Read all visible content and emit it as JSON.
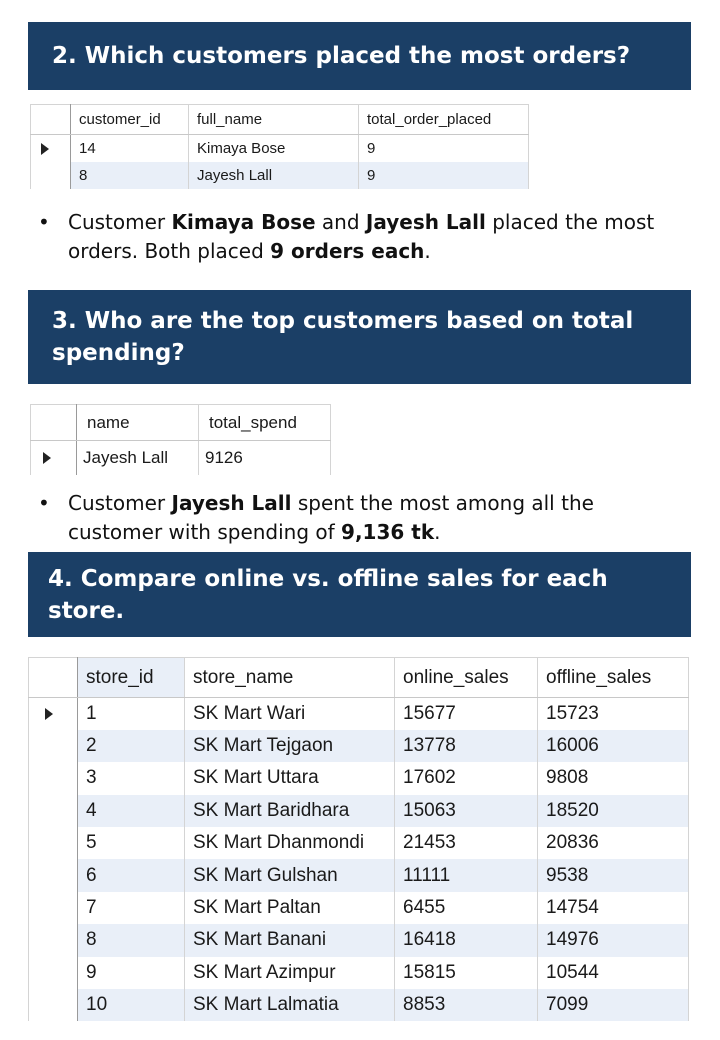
{
  "q2": {
    "heading": "2. Which customers placed the most orders?",
    "table": {
      "columns": [
        "customer_id",
        "full_name",
        "total_order_placed"
      ],
      "rows": [
        [
          "14",
          "Kimaya Bose",
          "9"
        ],
        [
          "8",
          "Jayesh Lall",
          "9"
        ]
      ]
    },
    "summary": {
      "bullet": "•",
      "t1": "Customer ",
      "b1": "Kimaya Bose",
      "t2": " and ",
      "b2": "Jayesh Lall",
      "t3": " placed the most orders. Both placed ",
      "b3": "9 orders each",
      "t4": "."
    }
  },
  "q3": {
    "heading": "3. Who are the top customers based on total spending?",
    "table": {
      "columns": [
        "name",
        "total_spend"
      ],
      "rows": [
        [
          "Jayesh Lall",
          "9126"
        ]
      ]
    },
    "summary": {
      "bullet": "•",
      "t1": "Customer ",
      "b1": "Jayesh Lall",
      "t2": " spent the most among all the customer with spending of ",
      "b2": "9,136 tk",
      "t3": "."
    }
  },
  "q4": {
    "heading": "4. Compare online vs. offline sales for each store.",
    "table": {
      "columns": [
        "store_id",
        "store_name",
        "online_sales",
        "offline_sales"
      ],
      "rows": [
        [
          "1",
          "SK Mart Wari",
          "15677",
          "15723"
        ],
        [
          "2",
          "SK Mart Tejgaon",
          "13778",
          "16006"
        ],
        [
          "3",
          "SK Mart Uttara",
          "17602",
          "9808"
        ],
        [
          "4",
          "SK Mart Baridhara",
          "15063",
          "18520"
        ],
        [
          "5",
          "SK Mart Dhanmondi",
          "21453",
          "20836"
        ],
        [
          "6",
          "SK Mart Gulshan",
          "11111",
          "9538"
        ],
        [
          "7",
          "SK Mart Paltan",
          "6455",
          "14754"
        ],
        [
          "8",
          "SK Mart Banani",
          "16418",
          "14976"
        ],
        [
          "9",
          "SK Mart Azimpur",
          "15815",
          "10544"
        ],
        [
          "10",
          "SK Mart Lalmatia",
          "8853",
          "7099"
        ]
      ]
    }
  }
}
